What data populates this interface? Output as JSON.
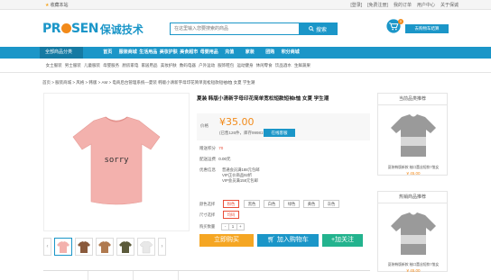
{
  "topbar": {
    "favorite": "收藏本站",
    "links": [
      "[登录]",
      "[免费注册]",
      "我的订单",
      "用户中心",
      "关于保诚"
    ]
  },
  "logo": {
    "en": "PR",
    "en_rest": "SEN",
    "cn": "保诚技术"
  },
  "search": {
    "placeholder": "在这里输入您要搜索的商品",
    "button": "搜索"
  },
  "cart": {
    "count": "0",
    "button": "去购物车结算"
  },
  "nav": {
    "category": "全部商品分类",
    "items": [
      "首页",
      "服装商城",
      "生活用品",
      "美妆护肤",
      "美食超市",
      "母婴用品",
      "充值",
      "家装",
      "团购",
      "积分商城"
    ]
  },
  "subnav": [
    "女士服装",
    "男士服装",
    "儿童服装",
    "母婴服务",
    "厨房家电",
    "家居用品",
    "美妆护肤",
    "数码电器",
    "户外运动",
    "服饰鞋包",
    "运动健身",
    "休闲零食",
    "饮品酒水",
    "生鲜蔬果"
  ],
  "breadcrumb": "首页 > 服装商城 > 风格 > 韩版 > AM > 电商后台管理系统—夏装 韩版小清新字母印花简单宽松短款短袖t恤 女夏 学生潮",
  "product": {
    "title": "夏装 韩版小清新字母印花简单宽松短款短袖t恤 女夏 学生潮",
    "price_label": "价格",
    "price": "¥35.00",
    "stock": "(已售126件，库存99981件)",
    "service_button": "在线客服",
    "points_label": "赠送积分",
    "points": "70",
    "shipping_label": "配送运费",
    "shipping": "0.00元",
    "promo_label": "优惠信息",
    "promos": [
      "普通会员满188元包邮",
      "VIP正价商品92折",
      "VIP会员满158元包邮"
    ],
    "color_label": "颜色选择",
    "colors": [
      "粉色",
      "黑色",
      "白色",
      "绿色",
      "黄色",
      "灰色"
    ],
    "size_label": "尺寸选择",
    "sizes": [
      "均码"
    ],
    "qty_label": "购买数量",
    "qty_minus": "-",
    "qty": "1",
    "qty_plus": "+",
    "buy_now": "立即购买",
    "add_cart": "加入购物车",
    "follow": "+加关注"
  },
  "sidebar": [
    {
      "heading": "当前品类推荐",
      "name": "夏装韩版新款 袖口蕾丝短款T恤女",
      "price": "¥ 45.00"
    },
    {
      "heading": "热销商品推荐",
      "name": "夏装韩版新款 袖口蕾丝短款T恤女",
      "price": "¥ 45.00"
    }
  ],
  "shirt_text": "sorry",
  "colors": {
    "brand": "#1b96c8",
    "accent": "#f28a1a",
    "buy": "#f5a623",
    "follow": "#23b38e",
    "pink": "#f3b1ad"
  }
}
